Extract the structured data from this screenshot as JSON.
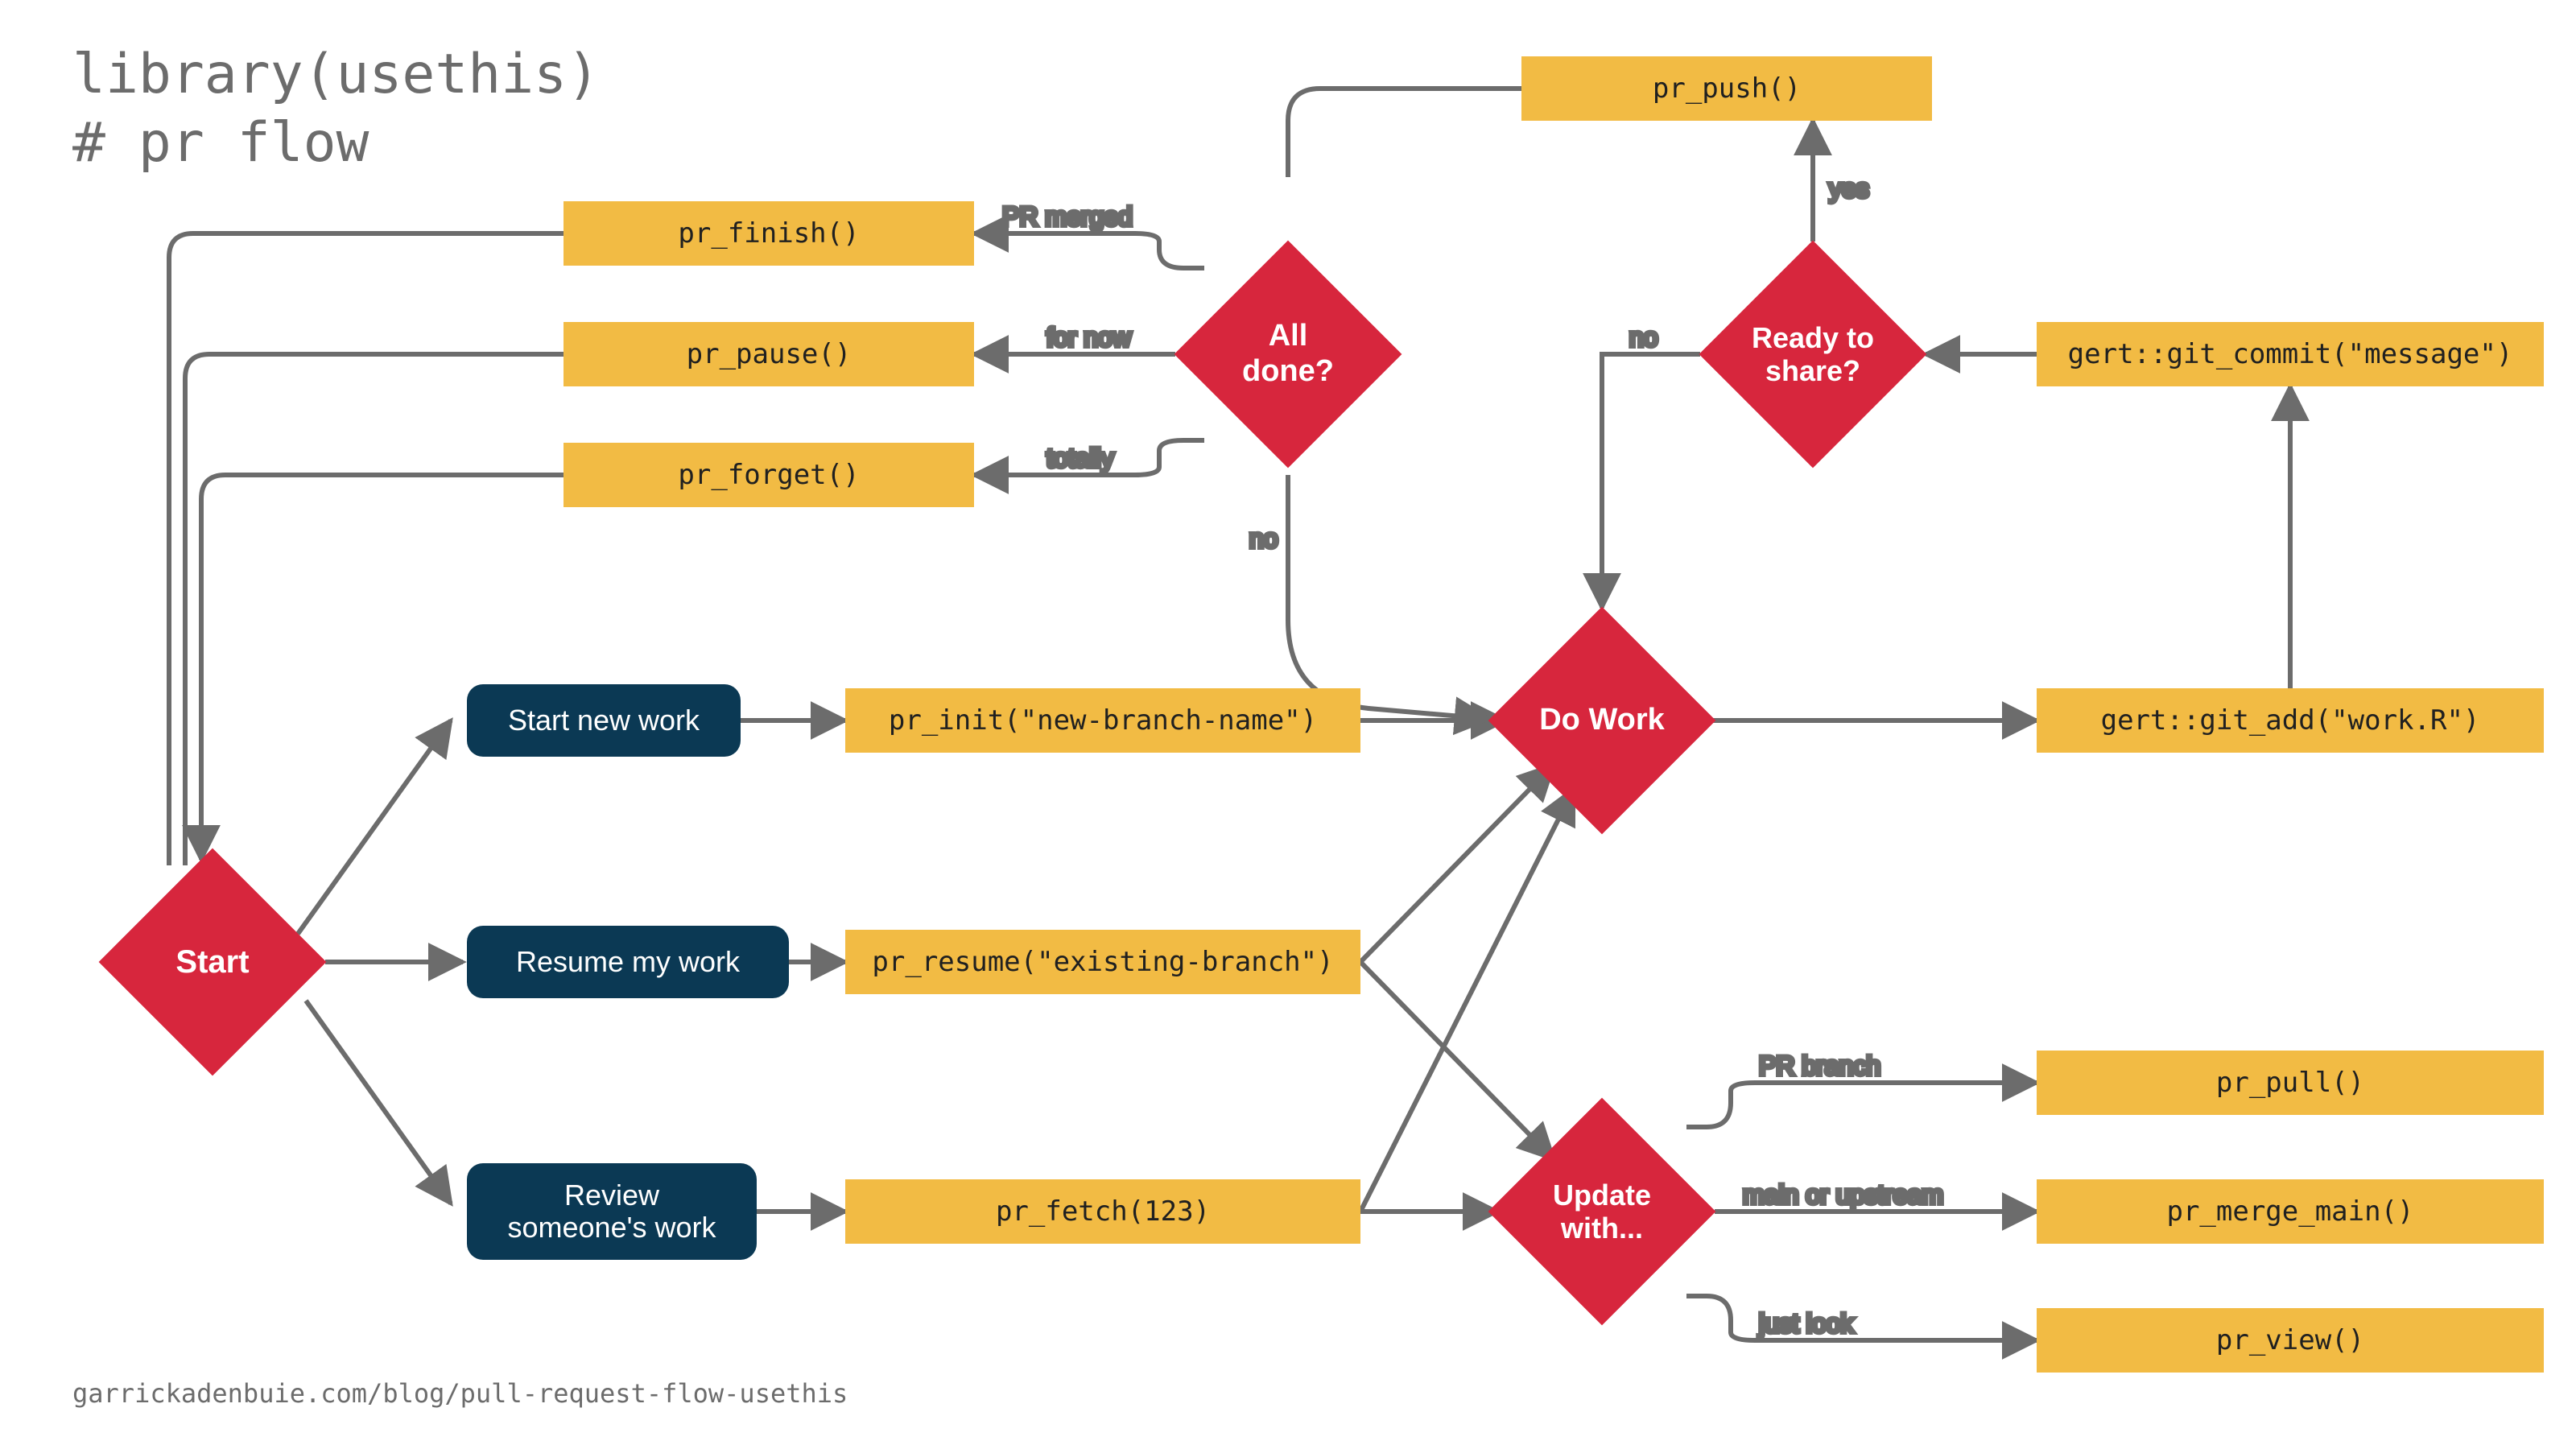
{
  "title": "library(usethis)\n# pr flow",
  "footer": "garrickadenbuie.com/blog/pull-request-flow-usethis",
  "colors": {
    "yellow": "#f2bb44",
    "red": "#d7263d",
    "navy": "#0b3954",
    "grey": "#6c6c6c"
  },
  "nodes": {
    "start": {
      "label": "Start",
      "type": "diamond"
    },
    "all_done": {
      "label": "All\ndone?",
      "type": "diamond"
    },
    "ready_to_share": {
      "label": "Ready to\nshare?",
      "type": "diamond"
    },
    "do_work": {
      "label": "Do Work",
      "type": "diamond"
    },
    "update_with": {
      "label": "Update\nwith...",
      "type": "diamond"
    },
    "start_new_work": {
      "label": "Start new work",
      "type": "navy"
    },
    "resume_my_work": {
      "label": "Resume my work",
      "type": "navy"
    },
    "review_someones_work": {
      "label": "Review\nsomeone's work",
      "type": "navy"
    },
    "pr_finish": {
      "label": "pr_finish()",
      "type": "yellow"
    },
    "pr_pause": {
      "label": "pr_pause()",
      "type": "yellow"
    },
    "pr_forget": {
      "label": "pr_forget()",
      "type": "yellow"
    },
    "pr_push": {
      "label": "pr_push()",
      "type": "yellow"
    },
    "pr_init": {
      "label": "pr_init(\"new-branch-name\")",
      "type": "yellow"
    },
    "pr_resume": {
      "label": "pr_resume(\"existing-branch\")",
      "type": "yellow"
    },
    "pr_fetch": {
      "label": "pr_fetch(123)",
      "type": "yellow"
    },
    "git_commit": {
      "label": "gert::git_commit(\"message\")",
      "type": "yellow"
    },
    "git_add": {
      "label": "gert::git_add(\"work.R\")",
      "type": "yellow"
    },
    "pr_pull": {
      "label": "pr_pull()",
      "type": "yellow"
    },
    "pr_merge_main": {
      "label": "pr_merge_main()",
      "type": "yellow"
    },
    "pr_view": {
      "label": "pr_view()",
      "type": "yellow"
    }
  },
  "edge_labels": {
    "pr_merged": "PR merged",
    "for_now": "for now",
    "totally": "totally",
    "no": "no",
    "yes": "yes",
    "pr_branch": "PR branch",
    "main_or_upstream": "main or upstream",
    "just_look": "just look"
  }
}
